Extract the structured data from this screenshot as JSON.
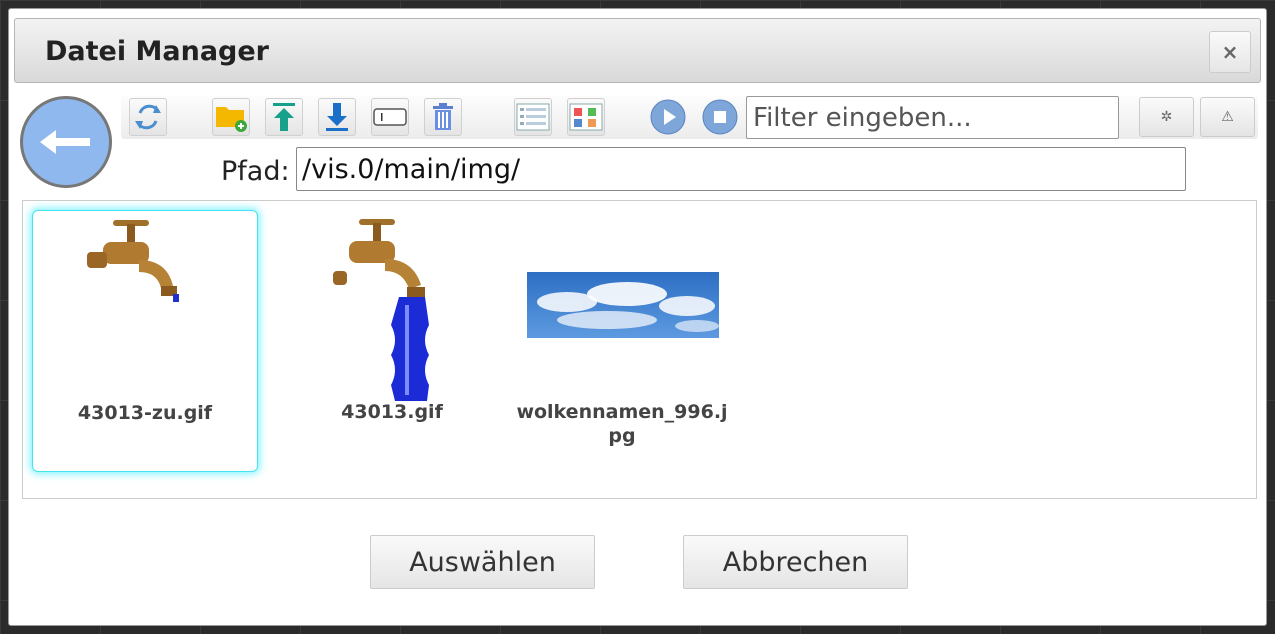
{
  "dialog": {
    "title": "Datei Manager",
    "close_icon": "×"
  },
  "toolbar": {
    "filter_placeholder": "Filter eingeben...",
    "buttons": [
      "back-arrow-icon",
      "refresh-icon",
      "new-folder-icon",
      "upload-icon",
      "download-icon",
      "rename-icon",
      "delete-icon",
      "list-view-icon",
      "table-view-icon",
      "play-icon",
      "stop-icon",
      "settings-icon",
      "warning-icon"
    ],
    "settings_glyph": "✲",
    "warning_glyph": "⚠"
  },
  "path": {
    "label": "Pfad:",
    "value": "/vis.0/main/img/"
  },
  "files": [
    {
      "name": "43013-zu.gif",
      "selected": true
    },
    {
      "name": "43013.gif",
      "selected": false
    },
    {
      "name": "wolkennamen_996.jpg",
      "selected": false
    }
  ],
  "footer": {
    "select_label": "Auswählen",
    "cancel_label": "Abbrechen"
  },
  "colors": {
    "accent": "#8fb8ef",
    "selection_glow": "#43e3f0"
  }
}
